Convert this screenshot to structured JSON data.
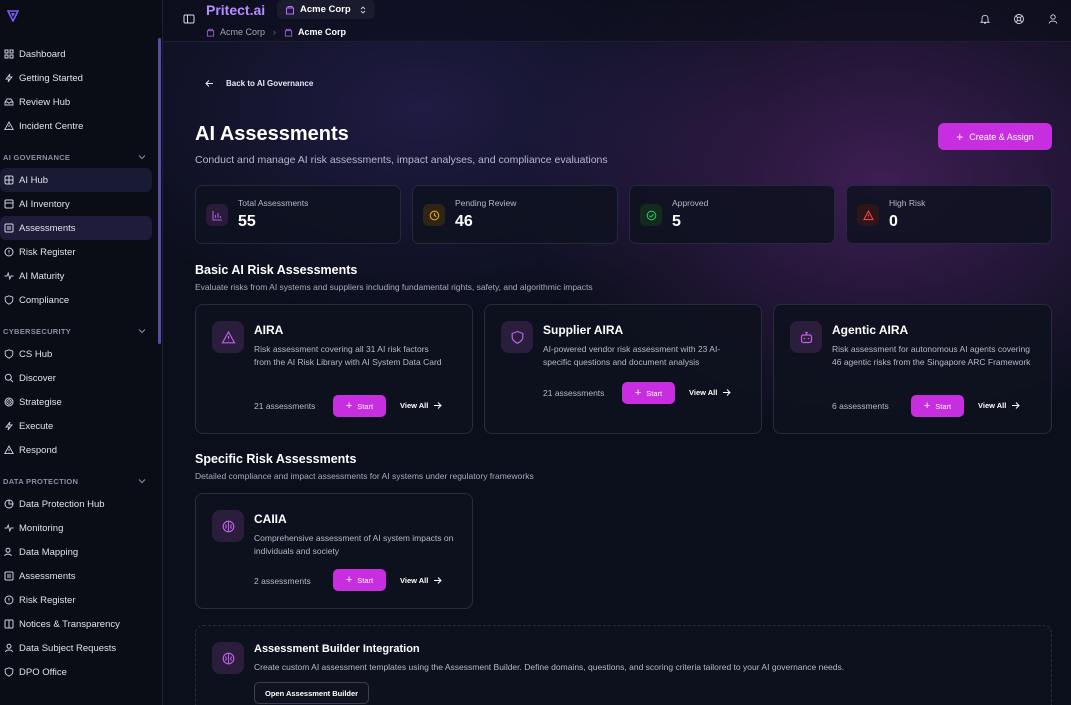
{
  "sidebar": {
    "top_items": [
      {
        "label": "Dashboard",
        "icon": "grid-icon"
      },
      {
        "label": "Getting Started",
        "icon": "zap-icon"
      },
      {
        "label": "Review Hub",
        "icon": "inbox-icon"
      },
      {
        "label": "Incident Centre",
        "icon": "alert-icon"
      }
    ],
    "sections": [
      {
        "title": "AI GOVERNANCE",
        "items": [
          {
            "label": "AI Hub",
            "icon": "grid-icon"
          },
          {
            "label": "AI Inventory",
            "icon": "grid-icon"
          },
          {
            "label": "Assessments",
            "icon": "grid-icon"
          },
          {
            "label": "Risk Register",
            "icon": "alert-circle-icon"
          },
          {
            "label": "AI Maturity",
            "icon": "activity-icon"
          },
          {
            "label": "Compliance",
            "icon": "shield-icon"
          }
        ]
      },
      {
        "title": "CYBERSECURITY",
        "items": [
          {
            "label": "CS Hub",
            "icon": "shield-icon"
          },
          {
            "label": "Discover",
            "icon": "search-icon"
          },
          {
            "label": "Strategise",
            "icon": "target-icon"
          },
          {
            "label": "Execute",
            "icon": "zap-icon"
          },
          {
            "label": "Respond",
            "icon": "alert-icon"
          }
        ]
      },
      {
        "title": "DATA PROTECTION",
        "items": [
          {
            "label": "Data Protection Hub",
            "icon": "pie-icon"
          },
          {
            "label": "Monitoring",
            "icon": "activity-icon"
          },
          {
            "label": "Data Mapping",
            "icon": "users-icon"
          },
          {
            "label": "Assessments",
            "icon": "grid-icon"
          },
          {
            "label": "Risk Register",
            "icon": "alert-circle-icon"
          },
          {
            "label": "Notices & Transparency",
            "icon": "grid-icon"
          },
          {
            "label": "Data Subject Requests",
            "icon": "user-icon"
          },
          {
            "label": "DPO Office",
            "icon": "shield-icon"
          }
        ]
      }
    ]
  },
  "header": {
    "brand": "Pritect.ai",
    "org": "Acme Corp",
    "breadcrumb": [
      "Acme Corp",
      "Acme Corp"
    ]
  },
  "page": {
    "back_label": "Back to AI Governance",
    "title": "AI Assessments",
    "subtitle": "Conduct and manage AI risk assessments, impact analyses, and compliance evaluations",
    "create_label": "Create & Assign"
  },
  "stats": [
    {
      "label": "Total Assessments",
      "value": "55",
      "color": "#b05ad8"
    },
    {
      "label": "Pending Review",
      "value": "46",
      "color": "#e8a21a"
    },
    {
      "label": "Approved",
      "value": "5",
      "color": "#22c55e"
    },
    {
      "label": "High Risk",
      "value": "0",
      "color": "#ef4444"
    }
  ],
  "basic": {
    "title": "Basic AI Risk Assessments",
    "subtitle": "Evaluate risks from AI systems and suppliers including fundamental rights, safety, and algorithmic impacts",
    "cards": [
      {
        "title": "AIRA",
        "desc": "Risk assessment covering all 31 AI risk factors from the AI Risk Library with AI System Data Card",
        "count": "21 assessments",
        "start": "Start",
        "view": "View All"
      },
      {
        "title": "Supplier AIRA",
        "desc": "AI-powered vendor risk assessment with 23 AI-specific questions and document analysis",
        "count": "21 assessments",
        "start": "Start",
        "view": "View All"
      },
      {
        "title": "Agentic AIRA",
        "desc": "Risk assessment for autonomous AI agents covering 46 agentic risks from the Singapore ARC Framework",
        "count": "6 assessments",
        "start": "Start",
        "view": "View All"
      }
    ]
  },
  "specific": {
    "title": "Specific Risk Assessments",
    "subtitle": "Detailed compliance and impact assessments for AI systems under regulatory frameworks",
    "cards": [
      {
        "title": "CAIIA",
        "desc": "Comprehensive assessment of AI system impacts on individuals and society",
        "count": "2 assessments",
        "start": "Start",
        "view": "View All"
      }
    ]
  },
  "builder": {
    "title": "Assessment Builder Integration",
    "desc": "Create custom AI assessment templates using the Assessment Builder. Define domains, questions, and scoring criteria tailored to your AI governance needs.",
    "button": "Open Assessment Builder"
  },
  "colors": {
    "accent": "#c72ee0",
    "brand": "#b68cff"
  }
}
